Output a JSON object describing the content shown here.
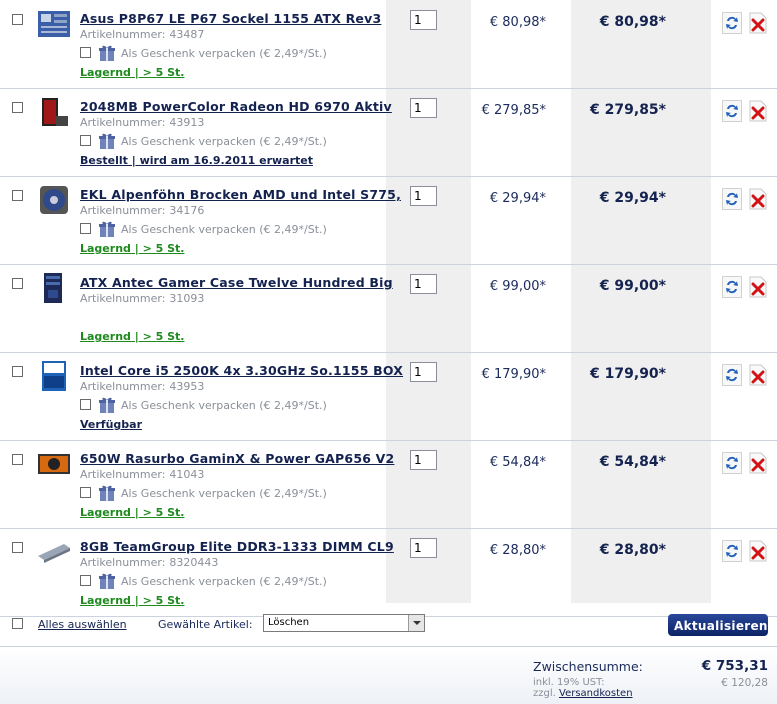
{
  "cart": {
    "items": [
      {
        "name": "Asus P8P67 LE P67 Sockel 1155 ATX Rev3",
        "artnr_label": "Artikelnummer:",
        "artnr": "43487",
        "gift": "Als Geschenk verpacken (€ 2,49*/St.)",
        "gift_visible": true,
        "stock": "Lagernd | > 5 St.",
        "stock_color": "#1f8a1f",
        "qty": "1",
        "price": "€ 80,98*",
        "total": "€ 80,98*",
        "thumb": "motherboard",
        "thumb_color": "#3a5ea8"
      },
      {
        "name": "2048MB PowerColor Radeon HD 6970 Aktiv",
        "artnr_label": "Artikelnummer:",
        "artnr": "43913",
        "gift": "Als Geschenk verpacken (€ 2,49*/St.)",
        "gift_visible": true,
        "stock": "Bestellt | wird am 16.9.2011 erwartet",
        "stock_color": "#14224f",
        "qty": "1",
        "price": "€ 279,85*",
        "total": "€ 279,85*",
        "thumb": "graphics-card",
        "thumb_color": "#a01818"
      },
      {
        "name": "EKL Alpenföhn Brocken AMD und Intel S775,",
        "artnr_label": "Artikelnummer:",
        "artnr": "34176",
        "gift": "Als Geschenk verpacken (€ 2,49*/St.)",
        "gift_visible": true,
        "stock": "Lagernd | > 5 St.",
        "stock_color": "#1f8a1f",
        "qty": "1",
        "price": "€ 29,94*",
        "total": "€ 29,94*",
        "thumb": "cpu-cooler",
        "thumb_color": "#2f4a8a"
      },
      {
        "name": "ATX Antec Gamer Case Twelve Hundred Big",
        "artnr_label": "Artikelnummer:",
        "artnr": "31093",
        "gift": "",
        "gift_visible": false,
        "stock": "Lagernd | > 5 St.",
        "stock_color": "#1f8a1f",
        "qty": "1",
        "price": "€ 99,00*",
        "total": "€ 99,00*",
        "thumb": "pc-case",
        "thumb_color": "#1c2a55"
      },
      {
        "name": "Intel Core i5 2500K 4x 3.30GHz So.1155 BOX",
        "artnr_label": "Artikelnummer:",
        "artnr": "43953",
        "gift": "Als Geschenk verpacken (€ 2,49*/St.)",
        "gift_visible": true,
        "stock": "Verfügbar",
        "stock_color": "#14224f",
        "qty": "1",
        "price": "€ 179,90*",
        "total": "€ 179,90*",
        "thumb": "processor-box",
        "thumb_color": "#1f63b8"
      },
      {
        "name": "650W Rasurbo GaminX & Power GAP656 V2",
        "artnr_label": "Artikelnummer:",
        "artnr": "41043",
        "gift": "Als Geschenk verpacken (€ 2,49*/St.)",
        "gift_visible": true,
        "stock": "Lagernd | > 5 St.",
        "stock_color": "#1f8a1f",
        "qty": "1",
        "price": "€ 54,84*",
        "total": "€ 54,84*",
        "thumb": "power-supply",
        "thumb_color": "#d76a10"
      },
      {
        "name": "8GB TeamGroup Elite DDR3-1333 DIMM CL9",
        "artnr_label": "Artikelnummer:",
        "artnr": "8320443",
        "gift": "Als Geschenk verpacken (€ 2,49*/St.)",
        "gift_visible": true,
        "stock": "Lagernd | > 5 St.",
        "stock_color": "#1f8a1f",
        "qty": "1",
        "price": "€ 28,80*",
        "total": "€ 28,80*",
        "thumb": "ram-module",
        "thumb_color": "#9aa6b5"
      }
    ],
    "row_icons": {
      "refresh": "refresh-icon",
      "delete": "delete-icon",
      "gift": "gift-icon"
    },
    "colors": {
      "refresh": "#1f5fb8",
      "delete": "#d21414",
      "accent": "#14224f"
    }
  },
  "footer": {
    "select_all": "Alles auswählen",
    "selected_label": "Gewählte Artikel:",
    "action_value": "Löschen",
    "update_button": "Aktualisieren"
  },
  "summary": {
    "subtotal_label": "Zwischensumme:",
    "subtotal_value": "€ 753,31",
    "tax_label": "inkl. 19% UST:",
    "tax_value": "€ 120,28",
    "shipping_prefix": "zzgl.",
    "shipping_link": "Versandkosten"
  }
}
